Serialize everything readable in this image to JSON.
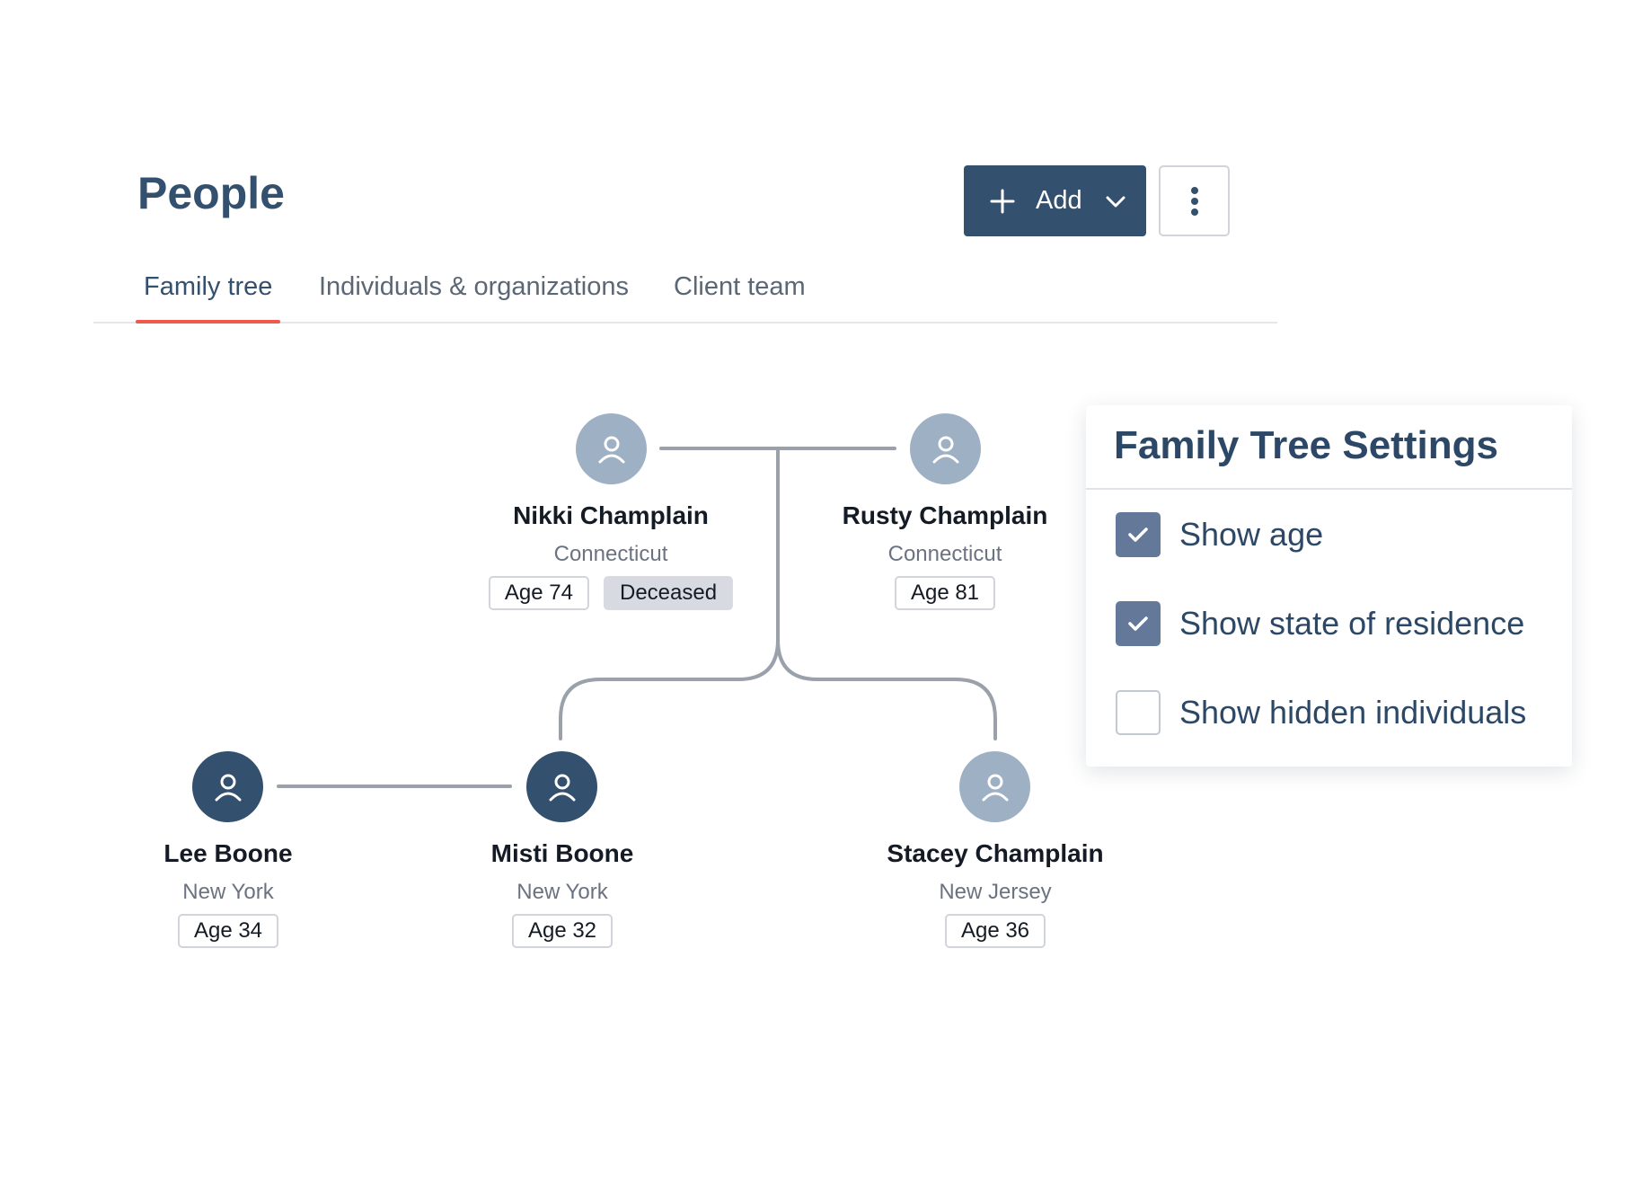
{
  "header": {
    "title": "People",
    "add_label": "Add",
    "add_icon": "plus-icon",
    "add_dropdown_icon": "chevron-down-icon",
    "more_icon": "more-vertical-icon"
  },
  "tabs": [
    {
      "label": "Family tree",
      "active": true
    },
    {
      "label": "Individuals & organizations",
      "active": false
    },
    {
      "label": "Client team",
      "active": false
    }
  ],
  "people": {
    "nikki": {
      "name": "Nikki Champlain",
      "state": "Connecticut",
      "age": "Age 74",
      "status": "Deceased"
    },
    "rusty": {
      "name": "Rusty Champlain",
      "state": "Connecticut",
      "age": "Age 81"
    },
    "lee": {
      "name": "Lee Boone",
      "state": "New York",
      "age": "Age 34"
    },
    "misti": {
      "name": "Misti Boone",
      "state": "New York",
      "age": "Age 32"
    },
    "stacey": {
      "name": "Stacey Champlain",
      "state": "New Jersey",
      "age": "Age 36"
    }
  },
  "settings": {
    "title": "Family Tree Settings",
    "options": [
      {
        "label": "Show age",
        "checked": true
      },
      {
        "label": "Show state of residence",
        "checked": true
      },
      {
        "label": "Show hidden individuals",
        "checked": false
      }
    ]
  },
  "colors": {
    "primary": "#34506f",
    "accent_underline": "#ef5a4c",
    "avatar_light": "#9eb0c4",
    "checkbox_checked": "#64799a",
    "connector": "#9aa1ab"
  }
}
